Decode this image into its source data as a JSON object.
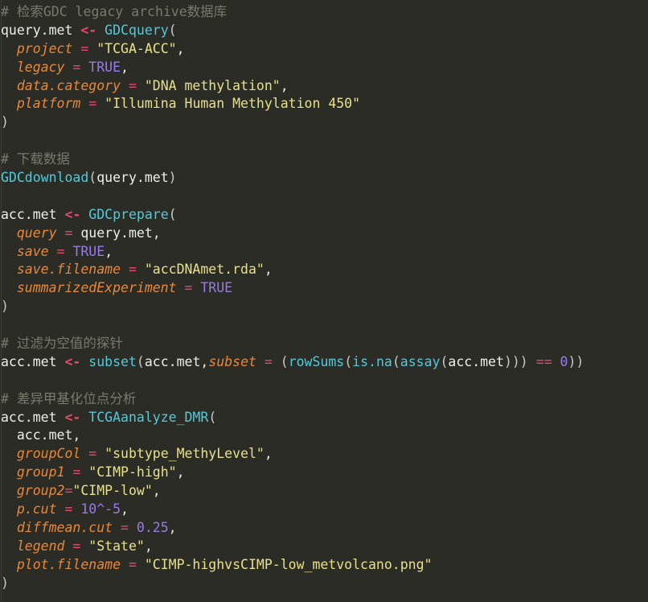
{
  "app": {
    "kind": "code-editor",
    "language": "R",
    "theme": "dark-olive",
    "background": "#2b2c26"
  },
  "colors": {
    "background": "#2b2c26",
    "comment": "#787a6d",
    "identifier": "#eceee7",
    "function": "#56c8d8",
    "assign_arrow": "#e8476f",
    "operator": "#e8476f",
    "parameter": "#e8883a",
    "string": "#e7e08a",
    "number": "#9a7ae8",
    "keyword": "#9a7ae8",
    "punctuation": "#e8e8e3",
    "indent_guide": "#3d3e37"
  },
  "code": {
    "lines": [
      {
        "id": "l1",
        "tokens": [
          {
            "t": "# 检索GDC legacy archive数据库",
            "c": "cmt"
          }
        ]
      },
      {
        "id": "l2",
        "tokens": [
          {
            "t": "query.met",
            "c": "id"
          },
          {
            "t": " ",
            "c": "punc"
          },
          {
            "t": "<-",
            "c": "arrow"
          },
          {
            "t": " ",
            "c": "punc"
          },
          {
            "t": "GDCquery",
            "c": "fn"
          },
          {
            "t": "(",
            "c": "paren"
          }
        ]
      },
      {
        "id": "l3",
        "tokens": [
          {
            "t": "  ",
            "c": "punc"
          },
          {
            "t": "project",
            "c": "param"
          },
          {
            "t": " ",
            "c": "punc"
          },
          {
            "t": "=",
            "c": "op"
          },
          {
            "t": " ",
            "c": "punc"
          },
          {
            "t": "\"TCGA-ACC\"",
            "c": "str"
          },
          {
            "t": ",",
            "c": "punc"
          }
        ]
      },
      {
        "id": "l4",
        "tokens": [
          {
            "t": "  ",
            "c": "punc"
          },
          {
            "t": "legacy",
            "c": "param"
          },
          {
            "t": " ",
            "c": "punc"
          },
          {
            "t": "=",
            "c": "op"
          },
          {
            "t": " ",
            "c": "punc"
          },
          {
            "t": "TRUE",
            "c": "kw"
          },
          {
            "t": ",",
            "c": "punc"
          }
        ]
      },
      {
        "id": "l5",
        "tokens": [
          {
            "t": "  ",
            "c": "punc"
          },
          {
            "t": "data.category",
            "c": "param"
          },
          {
            "t": " ",
            "c": "punc"
          },
          {
            "t": "=",
            "c": "op"
          },
          {
            "t": " ",
            "c": "punc"
          },
          {
            "t": "\"DNA methylation\"",
            "c": "str"
          },
          {
            "t": ",",
            "c": "punc"
          }
        ]
      },
      {
        "id": "l6",
        "tokens": [
          {
            "t": "  ",
            "c": "punc"
          },
          {
            "t": "platform",
            "c": "param"
          },
          {
            "t": " ",
            "c": "punc"
          },
          {
            "t": "=",
            "c": "op"
          },
          {
            "t": " ",
            "c": "punc"
          },
          {
            "t": "\"Illumina Human Methylation 450\"",
            "c": "str"
          }
        ]
      },
      {
        "id": "l7",
        "tokens": [
          {
            "t": ")",
            "c": "paren"
          }
        ]
      },
      {
        "id": "l8",
        "tokens": []
      },
      {
        "id": "l9",
        "tokens": [
          {
            "t": "# 下载数据",
            "c": "cmt"
          }
        ]
      },
      {
        "id": "l10",
        "tokens": [
          {
            "t": "GDCdownload",
            "c": "fn"
          },
          {
            "t": "(",
            "c": "paren"
          },
          {
            "t": "query.met",
            "c": "id"
          },
          {
            "t": ")",
            "c": "paren"
          }
        ]
      },
      {
        "id": "l11",
        "tokens": []
      },
      {
        "id": "l12",
        "tokens": [
          {
            "t": "acc.met",
            "c": "id"
          },
          {
            "t": " ",
            "c": "punc"
          },
          {
            "t": "<-",
            "c": "arrow"
          },
          {
            "t": " ",
            "c": "punc"
          },
          {
            "t": "GDCprepare",
            "c": "fn"
          },
          {
            "t": "(",
            "c": "paren"
          }
        ]
      },
      {
        "id": "l13",
        "tokens": [
          {
            "t": "  ",
            "c": "punc"
          },
          {
            "t": "query",
            "c": "param"
          },
          {
            "t": " ",
            "c": "punc"
          },
          {
            "t": "=",
            "c": "op"
          },
          {
            "t": " ",
            "c": "punc"
          },
          {
            "t": "query.met",
            "c": "id"
          },
          {
            "t": ",",
            "c": "punc"
          }
        ]
      },
      {
        "id": "l14",
        "tokens": [
          {
            "t": "  ",
            "c": "punc"
          },
          {
            "t": "save",
            "c": "param"
          },
          {
            "t": " ",
            "c": "punc"
          },
          {
            "t": "=",
            "c": "op"
          },
          {
            "t": " ",
            "c": "punc"
          },
          {
            "t": "TRUE",
            "c": "kw"
          },
          {
            "t": ",",
            "c": "punc"
          }
        ]
      },
      {
        "id": "l15",
        "tokens": [
          {
            "t": "  ",
            "c": "punc"
          },
          {
            "t": "save.filename",
            "c": "param"
          },
          {
            "t": " ",
            "c": "punc"
          },
          {
            "t": "=",
            "c": "op"
          },
          {
            "t": " ",
            "c": "punc"
          },
          {
            "t": "\"accDNAmet.rda\"",
            "c": "str"
          },
          {
            "t": ",",
            "c": "punc"
          }
        ]
      },
      {
        "id": "l16",
        "tokens": [
          {
            "t": "  ",
            "c": "punc"
          },
          {
            "t": "summarizedExperiment",
            "c": "param"
          },
          {
            "t": " ",
            "c": "punc"
          },
          {
            "t": "=",
            "c": "op"
          },
          {
            "t": " ",
            "c": "punc"
          },
          {
            "t": "TRUE",
            "c": "kw"
          }
        ]
      },
      {
        "id": "l17",
        "tokens": [
          {
            "t": ")",
            "c": "paren"
          }
        ]
      },
      {
        "id": "l18",
        "tokens": []
      },
      {
        "id": "l19",
        "tokens": [
          {
            "t": "# 过滤为空值的探针",
            "c": "cmt"
          }
        ]
      },
      {
        "id": "l20",
        "tokens": [
          {
            "t": "acc.met",
            "c": "id"
          },
          {
            "t": " ",
            "c": "punc"
          },
          {
            "t": "<-",
            "c": "arrow"
          },
          {
            "t": " ",
            "c": "punc"
          },
          {
            "t": "subset",
            "c": "fn"
          },
          {
            "t": "(",
            "c": "paren"
          },
          {
            "t": "acc.met",
            "c": "id"
          },
          {
            "t": ",",
            "c": "punc"
          },
          {
            "t": "subset",
            "c": "param"
          },
          {
            "t": " ",
            "c": "punc"
          },
          {
            "t": "=",
            "c": "op"
          },
          {
            "t": " ",
            "c": "punc"
          },
          {
            "t": "(",
            "c": "paren"
          },
          {
            "t": "rowSums",
            "c": "fn"
          },
          {
            "t": "(",
            "c": "paren"
          },
          {
            "t": "is.na",
            "c": "fn"
          },
          {
            "t": "(",
            "c": "paren"
          },
          {
            "t": "assay",
            "c": "fn"
          },
          {
            "t": "(",
            "c": "paren"
          },
          {
            "t": "acc.met",
            "c": "id"
          },
          {
            "t": ")))",
            "c": "paren"
          },
          {
            "t": " ",
            "c": "punc"
          },
          {
            "t": "==",
            "c": "op"
          },
          {
            "t": " ",
            "c": "punc"
          },
          {
            "t": "0",
            "c": "num"
          },
          {
            "t": "))",
            "c": "paren"
          }
        ]
      },
      {
        "id": "l21",
        "tokens": []
      },
      {
        "id": "l22",
        "tokens": [
          {
            "t": "# 差异甲基化位点分析",
            "c": "cmt"
          }
        ]
      },
      {
        "id": "l23",
        "tokens": [
          {
            "t": "acc.met",
            "c": "id"
          },
          {
            "t": " ",
            "c": "punc"
          },
          {
            "t": "<-",
            "c": "arrow"
          },
          {
            "t": " ",
            "c": "punc"
          },
          {
            "t": "TCGAanalyze_DMR",
            "c": "fn"
          },
          {
            "t": "(",
            "c": "paren"
          }
        ]
      },
      {
        "id": "l24",
        "tokens": [
          {
            "t": "  ",
            "c": "punc"
          },
          {
            "t": "acc.met",
            "c": "id"
          },
          {
            "t": ",",
            "c": "punc"
          }
        ]
      },
      {
        "id": "l25",
        "tokens": [
          {
            "t": "  ",
            "c": "punc"
          },
          {
            "t": "groupCol",
            "c": "param"
          },
          {
            "t": " ",
            "c": "punc"
          },
          {
            "t": "=",
            "c": "op"
          },
          {
            "t": " ",
            "c": "punc"
          },
          {
            "t": "\"subtype_MethyLevel\"",
            "c": "str"
          },
          {
            "t": ",",
            "c": "punc"
          }
        ]
      },
      {
        "id": "l26",
        "tokens": [
          {
            "t": "  ",
            "c": "punc"
          },
          {
            "t": "group1",
            "c": "param"
          },
          {
            "t": " ",
            "c": "punc"
          },
          {
            "t": "=",
            "c": "op"
          },
          {
            "t": " ",
            "c": "punc"
          },
          {
            "t": "\"CIMP-high\"",
            "c": "str"
          },
          {
            "t": ",",
            "c": "punc"
          }
        ]
      },
      {
        "id": "l27",
        "tokens": [
          {
            "t": "  ",
            "c": "punc"
          },
          {
            "t": "group2",
            "c": "param"
          },
          {
            "t": "=",
            "c": "op"
          },
          {
            "t": "\"CIMP-low\"",
            "c": "str"
          },
          {
            "t": ",",
            "c": "punc"
          }
        ]
      },
      {
        "id": "l28",
        "tokens": [
          {
            "t": "  ",
            "c": "punc"
          },
          {
            "t": "p.cut",
            "c": "param"
          },
          {
            "t": " ",
            "c": "punc"
          },
          {
            "t": "=",
            "c": "op"
          },
          {
            "t": " ",
            "c": "punc"
          },
          {
            "t": "10^-5",
            "c": "num"
          },
          {
            "t": ",",
            "c": "punc"
          }
        ]
      },
      {
        "id": "l29",
        "tokens": [
          {
            "t": "  ",
            "c": "punc"
          },
          {
            "t": "diffmean.cut",
            "c": "param"
          },
          {
            "t": " ",
            "c": "punc"
          },
          {
            "t": "=",
            "c": "op"
          },
          {
            "t": " ",
            "c": "punc"
          },
          {
            "t": "0.25",
            "c": "num"
          },
          {
            "t": ",",
            "c": "punc"
          }
        ]
      },
      {
        "id": "l30",
        "tokens": [
          {
            "t": "  ",
            "c": "punc"
          },
          {
            "t": "legend",
            "c": "param"
          },
          {
            "t": " ",
            "c": "punc"
          },
          {
            "t": "=",
            "c": "op"
          },
          {
            "t": " ",
            "c": "punc"
          },
          {
            "t": "\"State\"",
            "c": "str"
          },
          {
            "t": ",",
            "c": "punc"
          }
        ]
      },
      {
        "id": "l31",
        "tokens": [
          {
            "t": "  ",
            "c": "punc"
          },
          {
            "t": "plot.filename",
            "c": "param"
          },
          {
            "t": " ",
            "c": "punc"
          },
          {
            "t": "=",
            "c": "op"
          },
          {
            "t": " ",
            "c": "punc"
          },
          {
            "t": "\"CIMP-highvsCIMP-low_metvolcano.png\"",
            "c": "str"
          }
        ]
      },
      {
        "id": "l32",
        "tokens": [
          {
            "t": ")",
            "c": "paren"
          }
        ]
      }
    ]
  }
}
